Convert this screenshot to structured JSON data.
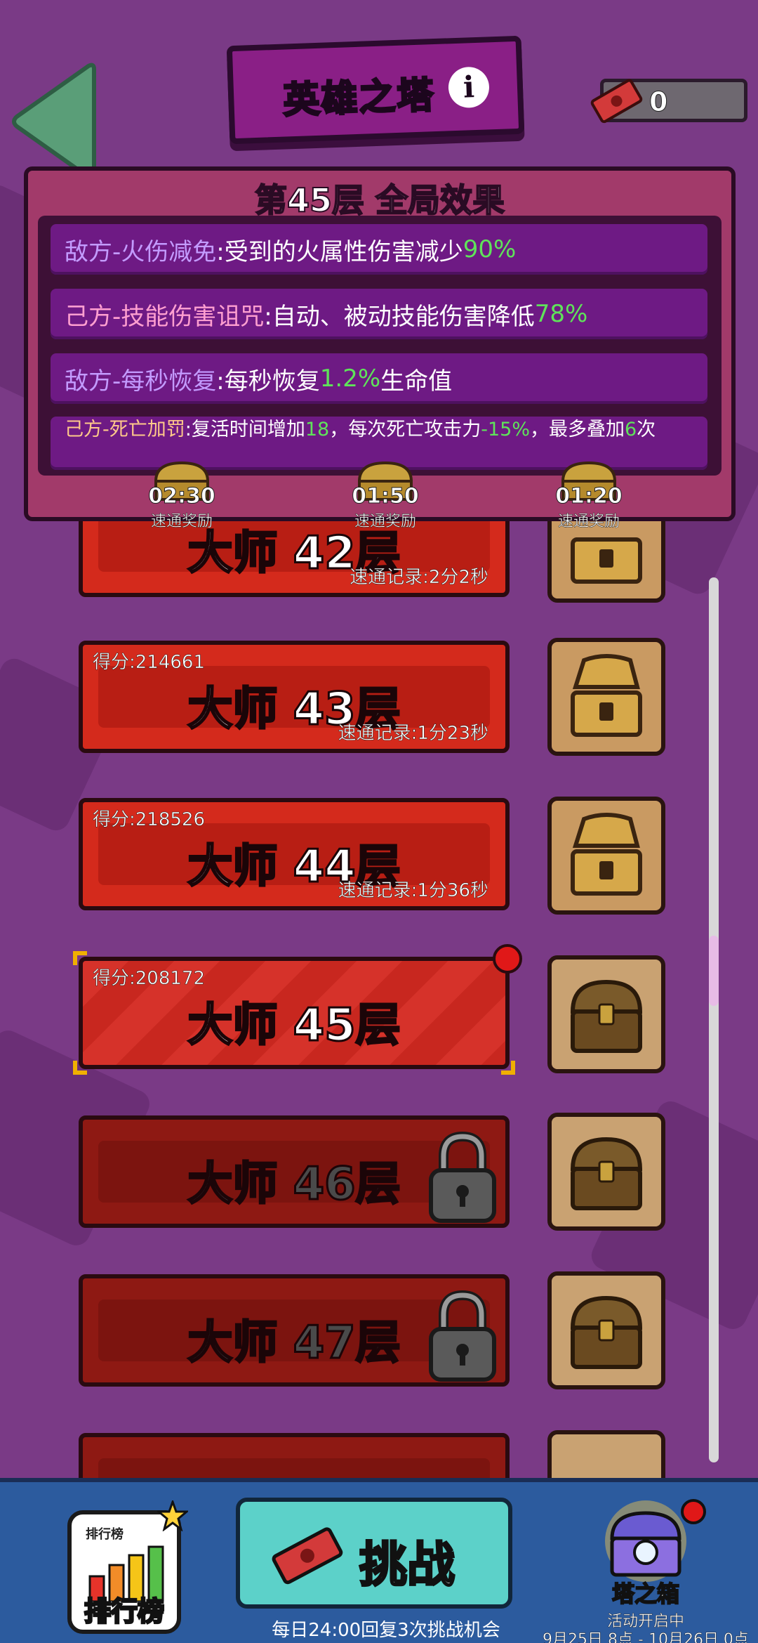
{
  "header": {
    "title": "英雄之塔",
    "ticket_count": "0"
  },
  "effects": {
    "title": "第45层 全局效果",
    "rows": [
      {
        "name": "敌方-火伤减免",
        "desc": ":受到的火属性伤害减少",
        "value": "90%",
        "tail": ""
      },
      {
        "name": "己方-技能伤害诅咒",
        "desc": ":自动、被动技能伤害降低",
        "value": "78%",
        "tail": ""
      },
      {
        "name": "敌方-每秒恢复",
        "desc": ":每秒恢复",
        "value": "1.2%",
        "tail": "生命值"
      },
      {
        "name": "己方-死亡加罚",
        "desc": ":复活时间增加",
        "value": "18",
        "tail": "，每次死亡攻击力",
        "value2": "-15%",
        "tail2": "，最多叠加",
        "value3": "6",
        "tail3": "次"
      }
    ]
  },
  "speed_rewards": [
    {
      "time": "02:30",
      "label": "速通奖励"
    },
    {
      "time": "01:50",
      "label": "速通奖励"
    },
    {
      "time": "01:20",
      "label": "速通奖励"
    }
  ],
  "floors": [
    {
      "name": "大师 42层",
      "record": "速通记录:2分2秒",
      "state": "cleared"
    },
    {
      "name": "大师 43层",
      "score": "得分:214661",
      "record": "速通记录:1分23秒",
      "state": "cleared"
    },
    {
      "name": "大师 44层",
      "score": "得分:218526",
      "record": "速通记录:1分36秒",
      "state": "cleared"
    },
    {
      "name": "大师 45层",
      "score": "得分:208172",
      "state": "current"
    },
    {
      "name": "大师 46层",
      "state": "locked"
    },
    {
      "name": "大师 47层",
      "state": "locked"
    }
  ],
  "bottom": {
    "rank_top_label": "排行榜",
    "rank_label": "排行榜",
    "challenge_label": "挑战",
    "challenge_note": "每日24:00回复3次挑战机会",
    "tower_chest_label": "塔之箱",
    "event_status": "活动开启中",
    "event_dates": "9月25日 8点 - 10月26日 0点"
  },
  "colors": {
    "background": "#7a3a86",
    "floor_red": "#d42a1c",
    "bottom_bar": "#2c5b9e",
    "challenge_btn": "#5cd1c9",
    "value_green": "#5fe35a"
  }
}
